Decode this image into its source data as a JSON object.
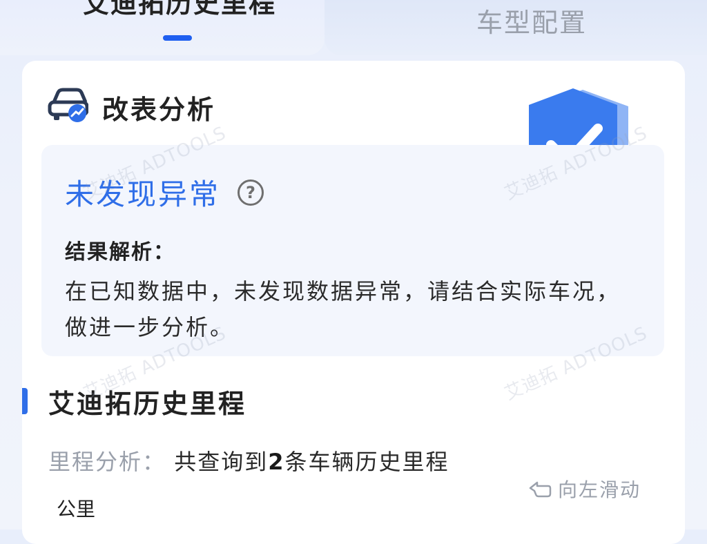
{
  "tabs": [
    {
      "label": "艾迪拓历史里程",
      "active": true
    },
    {
      "label": "车型配置",
      "active": false
    }
  ],
  "accent_color": "#2f6ee8",
  "modification_analysis": {
    "title": "改表分析",
    "icon": "car-chart-icon",
    "status": "未发现异常",
    "help_icon": "question-circle-icon",
    "status_icon": "shield-check-icon",
    "result_label": "结果解析：",
    "result_text": "在已知数据中，未发现数据异常，请结合实际车况，做进一步分析。"
  },
  "history": {
    "title": "艾迪拓历史里程",
    "analysis_label": "里程分析：",
    "analysis_prefix": "共查询到",
    "record_count": "2",
    "analysis_suffix": "条车辆历史里程",
    "swipe_hint": "向左滑动",
    "swipe_icon": "swipe-left-hand-icon",
    "unit": "公里"
  },
  "watermark": "艾迪拓 ADTOOLS"
}
